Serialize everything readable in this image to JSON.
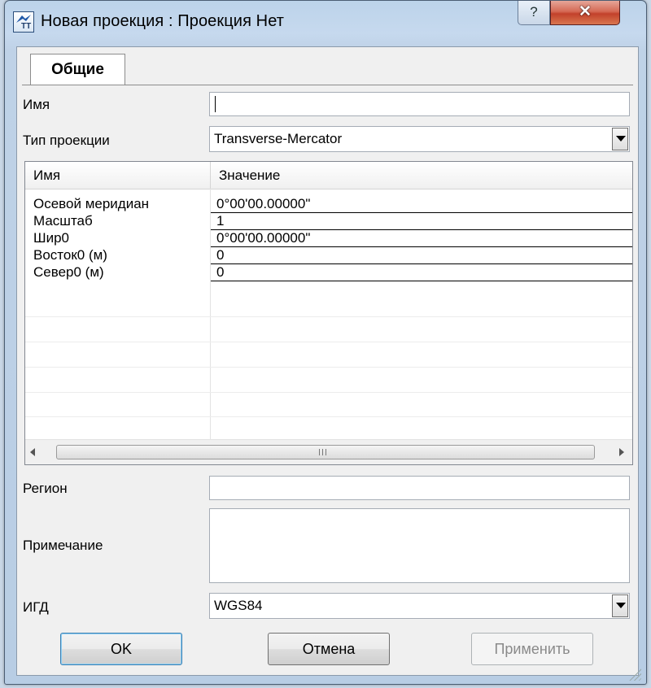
{
  "window": {
    "title": "Новая проекция : Проекция Нет",
    "help_glyph": "?",
    "close_glyph": "✕",
    "icon": "projection-app-icon",
    "icon_text": "TT"
  },
  "tabs": [
    {
      "label": "Общие",
      "active": true
    }
  ],
  "form": {
    "name_label": "Имя",
    "name_value": "",
    "projection_type_label": "Тип проекции",
    "projection_type_value": "Transverse-Mercator",
    "region_label": "Регион",
    "region_value": "",
    "note_label": "Примечание",
    "note_value": "",
    "datum_label": "ИГД",
    "datum_value": "WGS84"
  },
  "grid": {
    "columns": [
      "Имя",
      "Значение"
    ],
    "rows": [
      {
        "name": "Осевой меридиан",
        "value": "0°00'00.00000\""
      },
      {
        "name": "Масштаб",
        "value": "1"
      },
      {
        "name": "Шир0",
        "value": "0°00'00.00000\""
      },
      {
        "name": "Восток0 (м)",
        "value": "0"
      },
      {
        "name": "Север0 (м)",
        "value": "0"
      }
    ],
    "scroll_grip": "III"
  },
  "buttons": {
    "ok": "OK",
    "cancel": "Отмена",
    "apply": "Применить"
  },
  "colors": {
    "title_bar": "#bcd3ea",
    "close_button": "#c2412b",
    "panel": "#f0f0f0"
  }
}
